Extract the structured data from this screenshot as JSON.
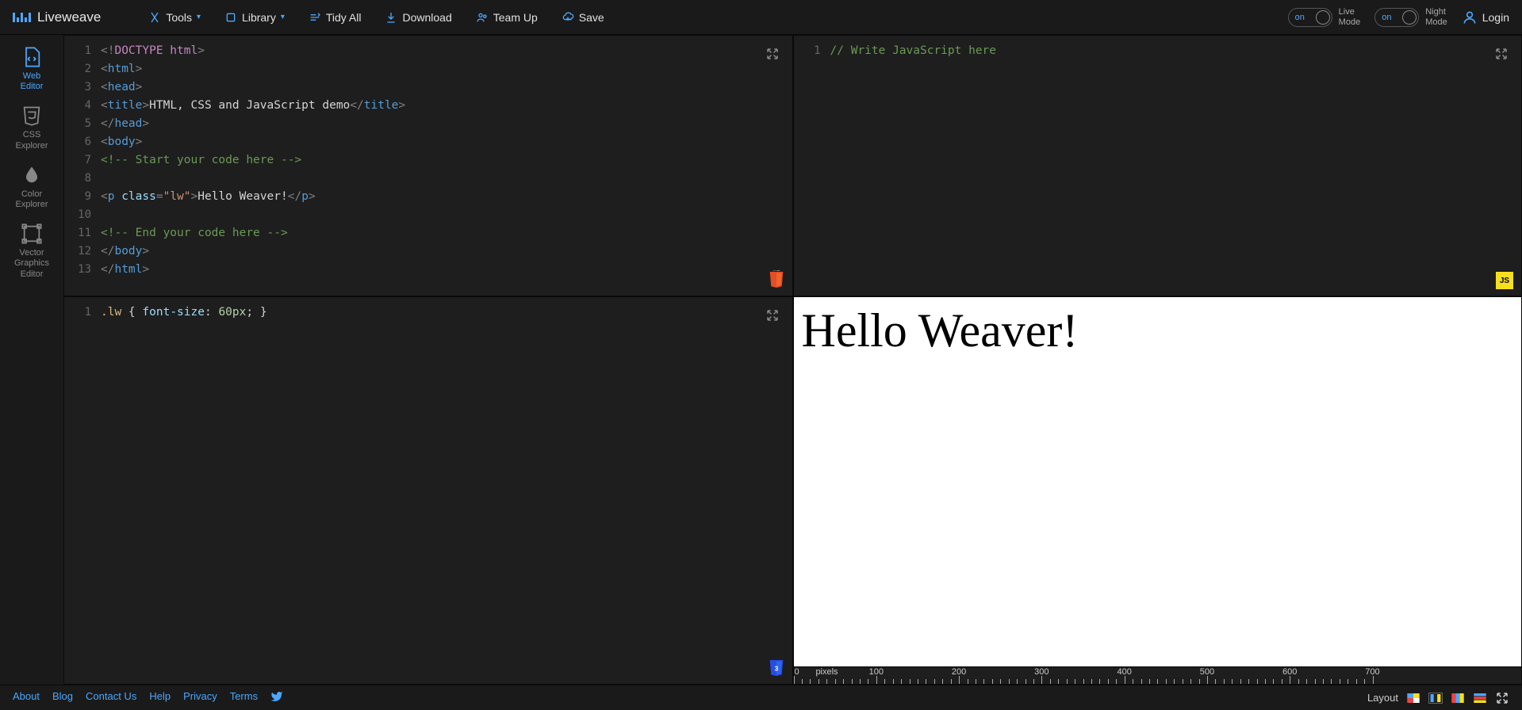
{
  "app": {
    "name": "Liveweave"
  },
  "menu": {
    "tools": "Tools",
    "library": "Library",
    "tidy": "Tidy All",
    "download": "Download",
    "teamup": "Team Up",
    "save": "Save"
  },
  "toggles": {
    "on": "on",
    "live1": "Live",
    "live2": "Mode",
    "night1": "Night",
    "night2": "Mode"
  },
  "login": "Login",
  "sidebar": {
    "items": [
      {
        "label1": "Web",
        "label2": "Editor"
      },
      {
        "label1": "CSS",
        "label2": "Explorer"
      },
      {
        "label1": "Color",
        "label2": "Explorer"
      },
      {
        "label1": "Vector",
        "label2": "Graphics",
        "label3": "Editor"
      }
    ]
  },
  "html": {
    "lines": [
      "1",
      "2",
      "3",
      "4",
      "5",
      "6",
      "7",
      "8",
      "9",
      "10",
      "11",
      "12",
      "13"
    ],
    "l1": "<!DOCTYPE html>",
    "l2o": "<html>",
    "l5c": "</head>",
    "l3": "<head>",
    "l4a": "<title>",
    "l4b": "HTML, CSS and JavaScript demo",
    "l4c": "</title>",
    "l6": "<body>",
    "l7": "<!-- Start your code here -->",
    "l9a": "<p",
    "l9b": " class",
    "l9c": "=",
    "l9d": "\"lw\"",
    "l9e": ">",
    "l9f": "Hello Weaver!",
    "l9g": "</p>",
    "l11": "<!-- End your code here -->",
    "l12": "</body>",
    "l13": "</html>"
  },
  "css": {
    "ln1": "1",
    "sel": ".lw",
    "ob": " { ",
    "prop": "font-size",
    "colon": ": ",
    "val": "60px",
    "semi": "; ",
    "cb": "}"
  },
  "js": {
    "ln1": "1",
    "comment": "// Write JavaScript here"
  },
  "preview": {
    "text": "Hello Weaver!"
  },
  "ruler": {
    "unit": "pixels",
    "ticks": [
      "0",
      "100",
      "200",
      "300",
      "400",
      "500",
      "600",
      "700"
    ]
  },
  "footer": {
    "links": [
      "About",
      "Blog",
      "Contact Us",
      "Help",
      "Privacy",
      "Terms"
    ],
    "layout": "Layout"
  },
  "badges": {
    "html": "HTML",
    "css": "3",
    "js": "JS"
  }
}
